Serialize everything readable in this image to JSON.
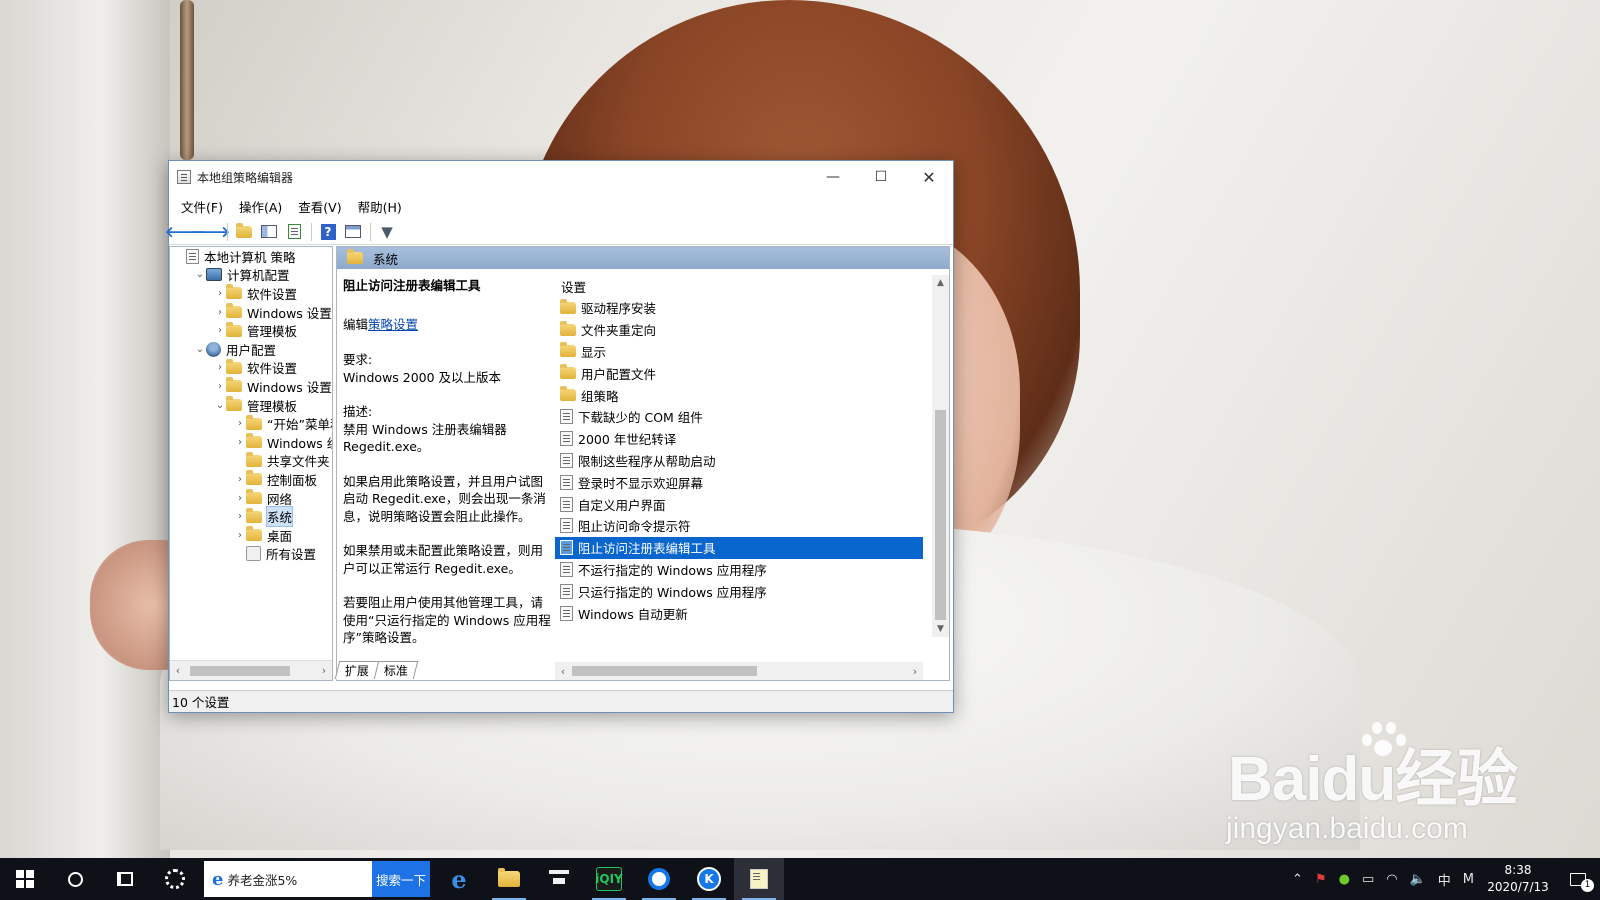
{
  "window": {
    "title": "本地组策略编辑器",
    "minimize": "—",
    "maximize": "☐",
    "close": "✕"
  },
  "menu": [
    "文件(F)",
    "操作(A)",
    "查看(V)",
    "帮助(H)"
  ],
  "toolbar_icons": [
    "back-arrow-icon",
    "forward-arrow-icon",
    "up-folder-icon",
    "show-hide-tree-icon",
    "export-list-icon",
    "help-icon",
    "properties-icon",
    "filter-icon"
  ],
  "tree": [
    {
      "label": "本地计算机 策略",
      "depth": 0,
      "toggle": "",
      "icon": "doc"
    },
    {
      "label": "计算机配置",
      "depth": 1,
      "toggle": "⌄",
      "icon": "pc"
    },
    {
      "label": "软件设置",
      "depth": 2,
      "toggle": "›",
      "icon": "folder"
    },
    {
      "label": "Windows 设置",
      "depth": 2,
      "toggle": "›",
      "icon": "folder"
    },
    {
      "label": "管理模板",
      "depth": 2,
      "toggle": "›",
      "icon": "folder"
    },
    {
      "label": "用户配置",
      "depth": 1,
      "toggle": "⌄",
      "icon": "user"
    },
    {
      "label": "软件设置",
      "depth": 2,
      "toggle": "›",
      "icon": "folder"
    },
    {
      "label": "Windows 设置",
      "depth": 2,
      "toggle": "›",
      "icon": "folder"
    },
    {
      "label": "管理模板",
      "depth": 2,
      "toggle": "⌄",
      "icon": "folder"
    },
    {
      "label": "“开始”菜单和",
      "depth": 3,
      "toggle": "›",
      "icon": "folder"
    },
    {
      "label": "Windows 组件",
      "depth": 3,
      "toggle": "›",
      "icon": "folder"
    },
    {
      "label": "共享文件夹",
      "depth": 3,
      "toggle": "",
      "icon": "folder"
    },
    {
      "label": "控制面板",
      "depth": 3,
      "toggle": "›",
      "icon": "folder"
    },
    {
      "label": "网络",
      "depth": 3,
      "toggle": "›",
      "icon": "folder"
    },
    {
      "label": "系统",
      "depth": 3,
      "toggle": "›",
      "icon": "folder",
      "selected": true
    },
    {
      "label": "桌面",
      "depth": 3,
      "toggle": "›",
      "icon": "folder"
    },
    {
      "label": "所有设置",
      "depth": 3,
      "toggle": "",
      "icon": "settings"
    }
  ],
  "detail": {
    "header": "系统",
    "policy_title": "阻止访问注册表编辑工具",
    "edit_prefix": "编辑",
    "edit_link": "策略设置",
    "req_label": "要求:",
    "req_value": "Windows 2000 及以上版本",
    "desc_label": "描述:",
    "desc_text": "禁用 Windows 注册表编辑器 Regedit.exe。",
    "para1": "如果启用此策略设置，并且用户试图启动 Regedit.exe，则会出现一条消息，说明策略设置会阻止此操作。",
    "para2": "如果禁用或未配置此策略设置，则用户可以正常运行 Regedit.exe。",
    "para3": "若要阻止用户使用其他管理工具，请使用“只运行指定的 Windows 应用程序”策略设置。",
    "list_header": "设置",
    "items": [
      {
        "label": "驱动程序安装",
        "type": "folder"
      },
      {
        "label": "文件夹重定向",
        "type": "folder"
      },
      {
        "label": "显示",
        "type": "folder"
      },
      {
        "label": "用户配置文件",
        "type": "folder"
      },
      {
        "label": "组策略",
        "type": "folder"
      },
      {
        "label": "下载缺少的 COM 组件",
        "type": "setting"
      },
      {
        "label": "2000 年世纪转译",
        "type": "setting"
      },
      {
        "label": "限制这些程序从帮助启动",
        "type": "setting"
      },
      {
        "label": "登录时不显示欢迎屏幕",
        "type": "setting"
      },
      {
        "label": "自定义用户界面",
        "type": "setting"
      },
      {
        "label": "阻止访问命令提示符",
        "type": "setting"
      },
      {
        "label": "阻止访问注册表编辑工具",
        "type": "setting",
        "selected": true
      },
      {
        "label": "不运行指定的 Windows 应用程序",
        "type": "setting"
      },
      {
        "label": "只运行指定的 Windows 应用程序",
        "type": "setting"
      },
      {
        "label": "Windows 自动更新",
        "type": "setting"
      }
    ]
  },
  "tabs": [
    "扩展",
    "标准"
  ],
  "status": "10 个设置",
  "watermark": {
    "main": "Baidu经验",
    "sub": "jingyan.baidu.com"
  },
  "taskbar": {
    "search_text": "养老金涨5%",
    "search_button": "搜索一下",
    "apps": [
      "edge-icon",
      "file-explorer-icon",
      "store-icon",
      "iqiyi-icon",
      "browser-q-icon",
      "kugou-icon",
      "notepad-icon"
    ],
    "iqiyi_label": "iQIY",
    "kugou_label": "K",
    "tray": {
      "ime": "中",
      "ime_mode": "M"
    },
    "time": "8:38",
    "date": "2020/7/13",
    "notifications": "1"
  },
  "colors": {
    "selection": "#0a66cf",
    "taskbar": "#0f1118",
    "search_button": "#1d73e5",
    "header_band": "#8ea9cb"
  }
}
